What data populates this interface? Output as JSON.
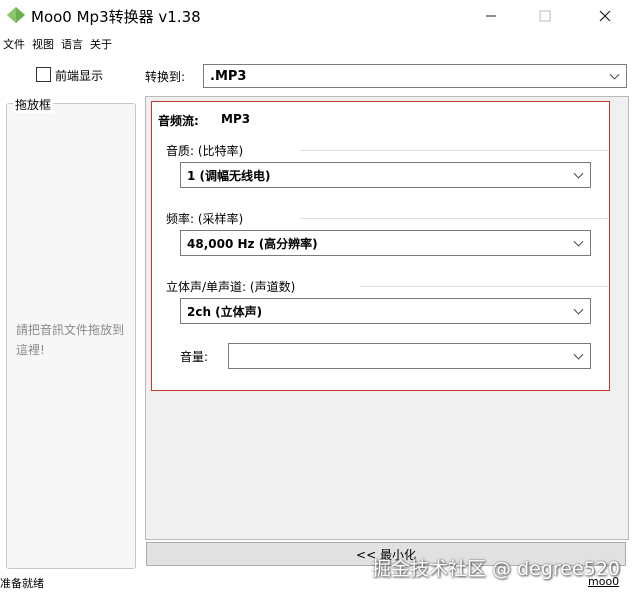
{
  "window": {
    "title": "Moo0 Mp3转换器 v1.38",
    "icons": [
      "app-icon",
      "minimize-icon",
      "maximize-icon",
      "close-icon"
    ]
  },
  "menu": [
    "文件",
    "视图",
    "语言",
    "关于"
  ],
  "left": {
    "always_on_top_label": "前端显示",
    "always_on_top_checked": false,
    "drop_group_title": "拖放框",
    "drop_hint": "請把音訊文件拖放到這裡!"
  },
  "convert": {
    "label": "转换到:",
    "format": ".MP3"
  },
  "settings": {
    "stream_label": "音频流:",
    "stream_value": "MP3",
    "quality_label": "音质:  (比特率)",
    "quality_value": "1   (调幅无线电)",
    "rate_label": "频率:  (采样率)",
    "rate_value": "48,000 Hz   (高分辨率)",
    "channel_label": "立体声/单声道:   (声道数)",
    "channel_value": "2ch   (立体声)",
    "volume_label": "音量:",
    "volume_value": ""
  },
  "minimize_button": "<< 最小化",
  "status": "准备就绪",
  "site_link": "moo0",
  "watermark": "掘金技术社区 @ degree520",
  "colors": {
    "accent_border": "#c0392b",
    "app_icon_green": "#6ab04c"
  }
}
